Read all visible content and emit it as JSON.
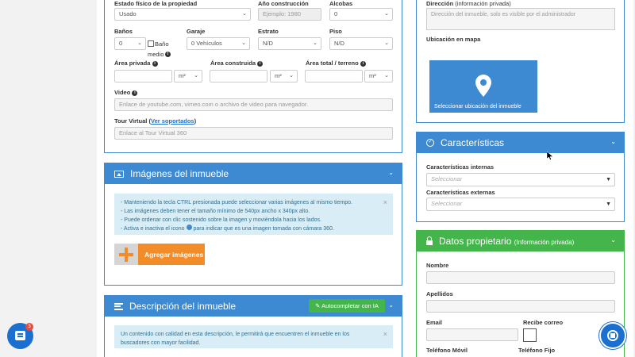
{
  "property": {
    "estado_label": "Estado físico de la propiedad",
    "estado_value": "Usado",
    "anio_label": "Año construcción",
    "anio_placeholder": "Ejemplo: 1980",
    "alcobas_label": "Alcobas",
    "alcobas_value": "0",
    "banos_label": "Baños",
    "banos_value": "0",
    "bano_medio_label1": "Baño",
    "bano_medio_label2": "medio",
    "garaje_label": "Garaje",
    "garaje_value": "0 Vehículos",
    "estrato_label": "Estrato",
    "estrato_value": "N/D",
    "piso_label": "Piso",
    "piso_value": "N/D",
    "area_privada_label": "Área privada",
    "area_construida_label": "Área construida",
    "area_total_label": "Área total / terreno",
    "unit": "m²",
    "video_label": "Video",
    "video_placeholder": "Enlace de youtube.com, vimeo.com o archivo de video para navegador.",
    "tour_label": "Tour Virtual (",
    "tour_link": "Ver soportados",
    "tour_label_end": ")",
    "tour_placeholder": "Enlace al Tour Virtual 360"
  },
  "images_card": {
    "title": "Imágenes del inmueble",
    "tips": [
      "- Manteniendo la tecla CTRL presionada puede seleccionar varias imágenes al mismo tiempo.",
      "- Las imágenes deben tener el tamaño mínimo de 540px ancho x 340px alto.",
      "- Puede ordenar con clic sostenido sobre la imagen y moviéndola hacia los lados."
    ],
    "tip4_a": "- Activa e inactiva el icono",
    "tip4_b": "para indicar que es una imagen tomada con cámara 360.",
    "add_button": "Agregar imágenes"
  },
  "description_card": {
    "title": "Descripción del inmueble",
    "ai_button": "Autocompletar con IA",
    "info_line1": "Un contenido con calidad en esta descripción, le permitirá que encuentren el inmueble en los",
    "info_line2": "buscadores con mayor facilidad."
  },
  "address": {
    "label": "Dirección",
    "label_note": "(información privada)",
    "placeholder": "Dirección del inmueble, solo es visible por el administrador",
    "map_label": "Ubicación en mapa",
    "map_button": "Seleccionar ubicación del inmueble"
  },
  "features_card": {
    "title": "Características",
    "internas_label": "Características internas",
    "externas_label": "Características externas",
    "select_placeholder": "Seleccionar"
  },
  "owner_card": {
    "title": "Datos propietario",
    "title_note": "(Información privada)",
    "nombre_label": "Nombre",
    "apellidos_label": "Apellidos",
    "email_label": "Email",
    "recibe_correo_label": "Recibe correo",
    "telefono_movil_label": "Teléfono Móvil",
    "telefono_fijo_label": "Teléfono Fijo"
  },
  "chat_widget": {
    "badge": "3"
  },
  "colors": {
    "primary": "#3d8ad3",
    "success": "#43b54a",
    "accent": "#f28c28"
  }
}
